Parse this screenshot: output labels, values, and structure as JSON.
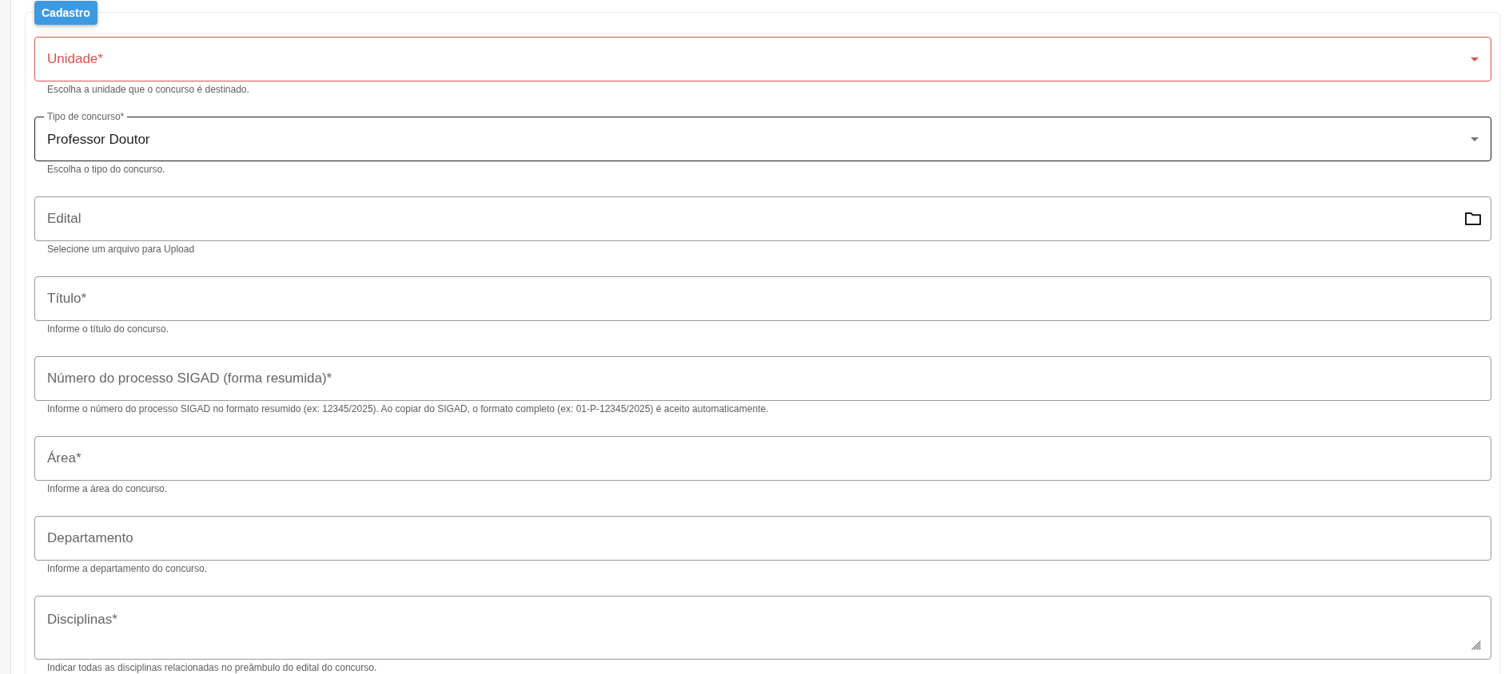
{
  "section": {
    "title": "Cadastro"
  },
  "fields": [
    {
      "kind": "select",
      "label": "Unidade*",
      "hint": "Escolha a unidade que o concurso é destinado.",
      "error": true,
      "focused": false
    },
    {
      "kind": "select",
      "label": "Tipo de concurso*",
      "value": "Professor Doutor",
      "hint": "Escolha o tipo do concurso.",
      "error": false,
      "focused": true
    },
    {
      "kind": "file",
      "label": "Edital",
      "hint": "Selecione um arquivo para Upload",
      "error": false,
      "focused": false
    },
    {
      "kind": "text",
      "label": "Título*",
      "hint": "Informe o título do concurso.",
      "error": false,
      "focused": false
    },
    {
      "kind": "text",
      "label": "Número do processo SIGAD (forma resumida)*",
      "hint": "Informe o número do processo SIGAD no formato resumido (ex: 12345/2025). Ao copiar do SIGAD, o formato completo (ex: 01-P-12345/2025) é aceito automaticamente.",
      "error": false,
      "focused": false
    },
    {
      "kind": "text",
      "label": "Área*",
      "hint": "Informe a área do concurso.",
      "error": false,
      "focused": false
    },
    {
      "kind": "text",
      "label": "Departamento",
      "hint": "Informe a departamento do concurso.",
      "error": false,
      "focused": false
    },
    {
      "kind": "textarea",
      "label": "Disciplinas*",
      "hint": "Indicar todas as disciplinas relacionadas no preâmbulo do edital do concurso.",
      "error": false,
      "focused": false
    }
  ]
}
